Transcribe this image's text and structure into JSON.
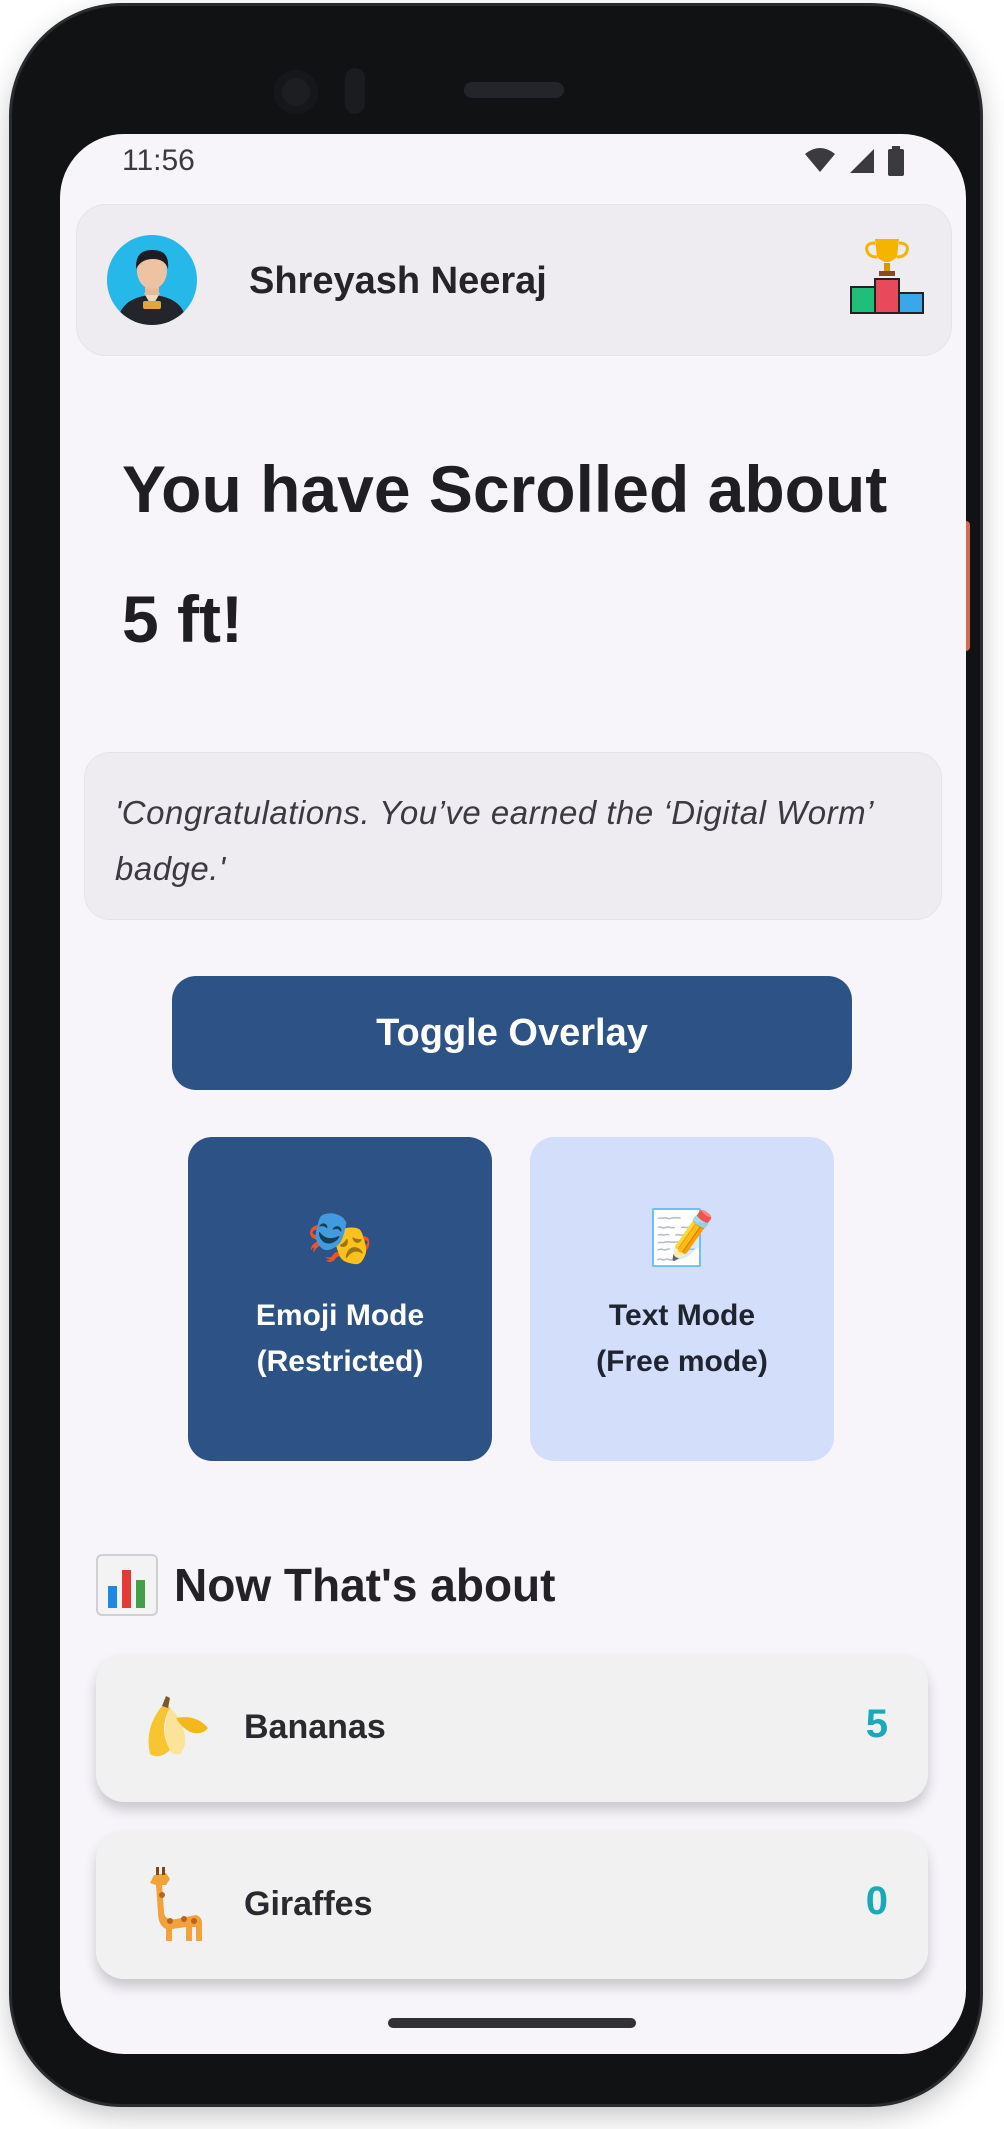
{
  "status_bar": {
    "time": "11:56",
    "icons": [
      "wifi-icon",
      "cellular-icon",
      "battery-icon"
    ]
  },
  "header": {
    "user_name": "Shreyash Neeraj",
    "avatar_icon": "user-avatar",
    "leaderboard_icon": "trophy-podium-icon"
  },
  "headline": "You have Scrolled about 5 ft!",
  "badge_message": "'Congratulations. You’ve earned the ‘Digital Worm’ badge.'",
  "toggle_button": {
    "label": "Toggle Overlay"
  },
  "modes": [
    {
      "icon": "🎭",
      "icon_name": "theater-masks-icon",
      "label": "Emoji Mode\n(Restricted)",
      "line1": "Emoji Mode",
      "line2": "(Restricted)",
      "selected": true
    },
    {
      "icon": "📝",
      "icon_name": "memo-icon",
      "label": "Text Mode\n(Free mode)",
      "line1": "Text Mode",
      "line2": "(Free mode)",
      "selected": false
    }
  ],
  "comparison": {
    "title": "Now That's about",
    "title_icon": "bar-chart-icon",
    "items": [
      {
        "label": "Bananas",
        "value": "5",
        "icon": "banana-icon"
      },
      {
        "label": "Giraffes",
        "value": "0",
        "icon": "giraffe-icon"
      }
    ]
  },
  "colors": {
    "primary": "#2c5286",
    "secondary_card": "#d3defb",
    "value_accent": "#19a9b8",
    "background": "#f7f4fa"
  }
}
